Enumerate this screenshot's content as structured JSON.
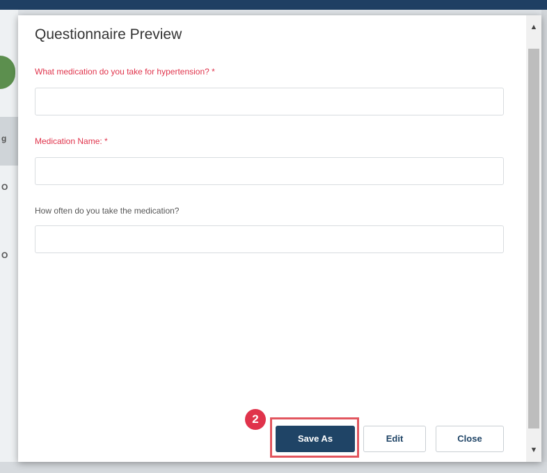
{
  "modal": {
    "title": "Questionnaire Preview",
    "questions": [
      {
        "label": "What medication do you take for hypertension? *",
        "value": "",
        "required": true
      },
      {
        "label": "Medication Name: *",
        "value": "",
        "required": true
      },
      {
        "label": "How often do you take the medication?",
        "value": "",
        "required": false
      }
    ],
    "buttons": {
      "save_as": "Save As",
      "edit": "Edit",
      "close": "Close"
    }
  },
  "annotation": {
    "step_number": "2"
  },
  "scrollbar": {
    "up_icon": "triangle-up-icon",
    "down_icon": "triangle-down-icon"
  },
  "background_fragments": [
    "g",
    "O",
    "O"
  ],
  "colors": {
    "required_label": "#e0334b",
    "primary_button": "#1f4466",
    "highlight": "#e2555e",
    "top_bar": "#1f3f63"
  }
}
